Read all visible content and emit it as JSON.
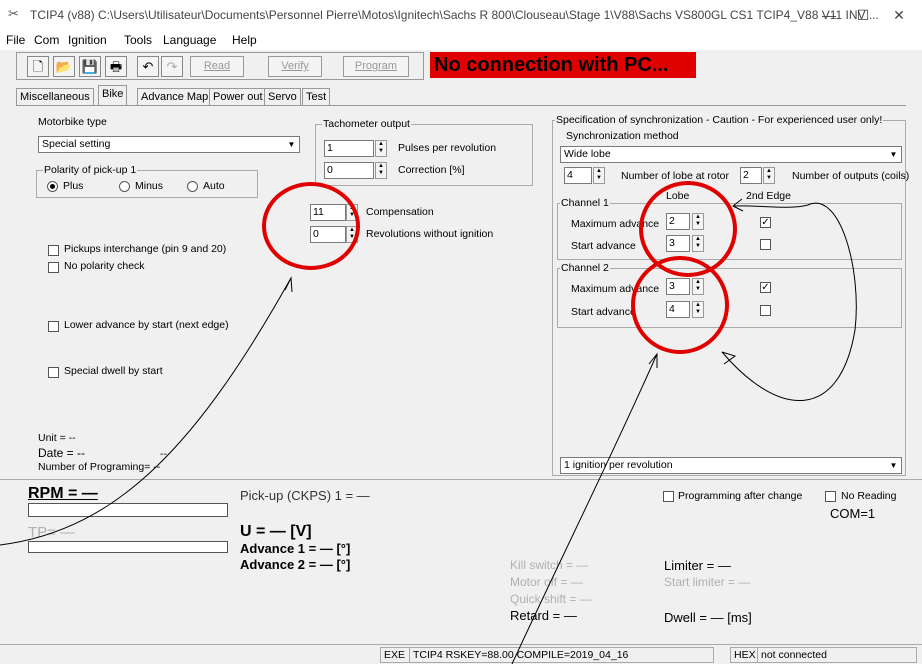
{
  "window": {
    "title": "TCIP4 (v88)     C:\\Users\\Utilisateur\\Documents\\Personnel Pierre\\Motos\\Ignitech\\Sachs R 800\\Clouseau\\Stage 1\\V88\\Sachs VS800GL CS1 TCIP4_V88 V11 INV ...",
    "minimize": "—",
    "maximize": "☐",
    "close": "✕"
  },
  "menu": [
    "File",
    "Com",
    "Ignition",
    "Tools",
    "Language",
    "Help"
  ],
  "toolbar": {
    "read": "Read",
    "verify": "Verify",
    "program": "Program"
  },
  "banner": "No connection with PC...",
  "tabs": [
    "Miscellaneous",
    "Bike",
    "Advance Map",
    "Power out",
    "Servo",
    "Test"
  ],
  "bike": {
    "motorbike_type_label": "Motorbike type",
    "motorbike_type_value": "Special setting",
    "polarity_label": "Polarity of pick-up 1",
    "polarity_options": [
      "Plus",
      "Minus",
      "Auto"
    ],
    "tacho_label": "Tachometer output",
    "pulses_value": "1",
    "pulses_label": "Pulses per revolution",
    "correction_value": "0",
    "correction_label": "Correction [%]",
    "compensation_value": "11",
    "compensation_label": "Compensation",
    "revs_value": "0",
    "revs_label": "Revolutions without ignition",
    "pickups_interchange": "Pickups interchange (pin 9 and 20)",
    "no_polarity_check": "No polarity check",
    "lower_advance": "Lower advance by start (next edge)",
    "special_dwell": "Special dwell by start",
    "unit": "Unit = --",
    "date": "Date = --",
    "date_extra": "--",
    "num_programing": "Number of Programing= --"
  },
  "sync": {
    "group_label": "Specification of synchronization - Caution - For experienced user only!",
    "method_label": "Synchronization method",
    "method_value": "Wide lobe",
    "lobes_value": "4",
    "lobes_label": "Number of lobe at rotor",
    "outputs_value": "2",
    "outputs_label": "Number of outputs (coils)",
    "col_lobe": "Lobe",
    "col_2nd_edge": "2nd Edge",
    "channel1_label": "Channel 1",
    "channel2_label": "Channel 2",
    "max_adv_label": "Maximum advance",
    "start_adv_label": "Start advance",
    "ch1_max": "2",
    "ch1_start": "3",
    "ch2_max": "3",
    "ch2_start": "4",
    "ignition_value": "1 ignition per revolution"
  },
  "status": {
    "rpm": "RPM = —",
    "tp": "TP= —",
    "pickup": "Pick-up (CKPS) 1 = —",
    "u": "U = — [V]",
    "adv1": "Advance 1 = — [°]",
    "adv2": "Advance 2 = — [°]",
    "kill_switch": "Kill switch = —",
    "motor_off": "Motor off = —",
    "quickshift": "Quick shift = —",
    "retard": "Retard = —",
    "limiter": "Limiter = —",
    "start_limiter": "Start limiter = —",
    "dwell": "Dwell = — [ms]",
    "prog_after_change": "Programming after change",
    "no_reading": "No Reading",
    "com": "COM=1"
  },
  "statusbar": {
    "exe": "EXE",
    "info": "TCIP4  RSKEY=88.00  COMPILE=2019_04_16",
    "hex": "HEX",
    "conn": "not connected"
  },
  "colors": {
    "banner": "#e00000",
    "annotation": "#e00000"
  }
}
